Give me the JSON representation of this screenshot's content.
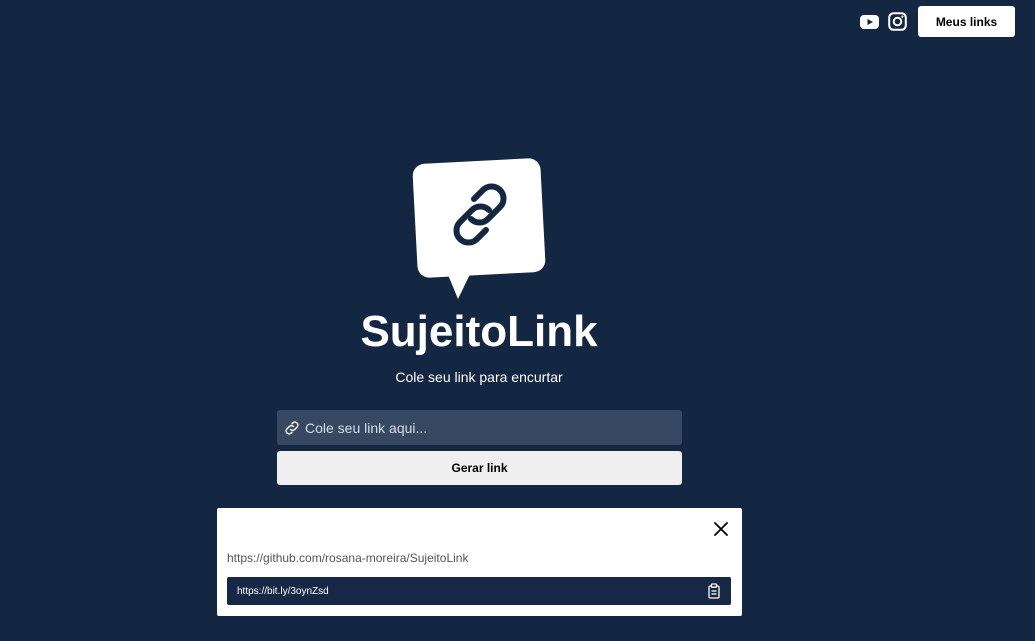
{
  "header": {
    "youtube_icon": "youtube-icon",
    "instagram_icon": "instagram-icon",
    "my_links_label": "Meus links"
  },
  "hero": {
    "logo_icon": "link-chat-logo",
    "title": "SujeitoLink",
    "subtitle": "Cole seu link para encurtar"
  },
  "form": {
    "input_icon": "link-icon",
    "input_placeholder": "Cole seu link aqui...",
    "input_value": "",
    "generate_label": "Gerar link"
  },
  "result": {
    "close_icon": "close-icon",
    "original_url": "https://github.com/rosana-moreira/SujeitoLink",
    "short_url": "https://bit.ly/3oynZsd",
    "copy_icon": "clipboard-icon"
  },
  "colors": {
    "background": "#132642",
    "input_bg": "#374962",
    "short_box_bg": "#172846",
    "button_bg": "#efefef"
  }
}
